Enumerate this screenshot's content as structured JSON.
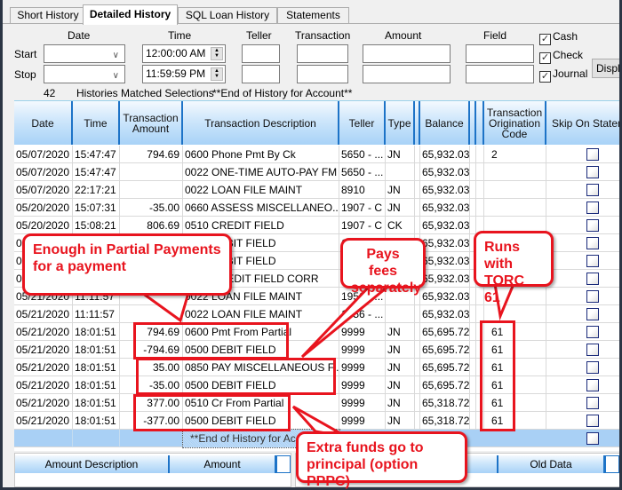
{
  "tabs": [
    {
      "label": "Short History",
      "active": false
    },
    {
      "label": "Detailed History",
      "active": true
    },
    {
      "label": "SQL Loan History",
      "active": false
    },
    {
      "label": "Statements",
      "active": false
    }
  ],
  "filters": {
    "headers": {
      "date": "Date",
      "time": "Time",
      "teller": "Teller",
      "transaction": "Transaction",
      "amount": "Amount",
      "field": "Field"
    },
    "start_label": "Start",
    "stop_label": "Stop",
    "start_date": "",
    "stop_date": "",
    "start_time": "12:00:00 AM",
    "stop_time": "11:59:59 PM",
    "checkboxes": [
      {
        "label": "Cash",
        "checked": true
      },
      {
        "label": "Check",
        "checked": true
      },
      {
        "label": "Journal",
        "checked": true
      }
    ],
    "display_button": "Display"
  },
  "status": {
    "count": "42",
    "matched_text": "Histories Matched Selections",
    "end_text": "**End of History for Account**"
  },
  "grid": {
    "columns": [
      "Date",
      "Time",
      "Transaction Amount",
      "Transaction Description",
      "Teller",
      "Type",
      "Balance",
      "Transaction Origination Code",
      "Skip On Statement"
    ],
    "rows": [
      {
        "date": "05/07/2020",
        "time": "15:47:47",
        "amount": "794.69",
        "desc": "0600 Phone Pmt By Ck",
        "teller": "5650 - ...",
        "type": "JN",
        "balance": "65,932.03",
        "torc": "2"
      },
      {
        "date": "05/07/2020",
        "time": "15:47:47",
        "amount": "",
        "desc": "0022 ONE-TIME AUTO-PAY FM",
        "teller": "5650 - ...",
        "type": "",
        "balance": "65,932.03",
        "torc": ""
      },
      {
        "date": "05/07/2020",
        "time": "22:17:21",
        "amount": "",
        "desc": "0022 LOAN FILE MAINT",
        "teller": "8910",
        "type": "JN",
        "balance": "65,932.03",
        "torc": ""
      },
      {
        "date": "05/20/2020",
        "time": "15:07:31",
        "amount": "-35.00",
        "desc": "0660 ASSESS MISCELLANEO...",
        "teller": "1907 - C",
        "type": "JN",
        "balance": "65,932.03",
        "torc": ""
      },
      {
        "date": "05/20/2020",
        "time": "15:08:21",
        "amount": "806.69",
        "desc": "0510 CREDIT FIELD",
        "teller": "1907 - C",
        "type": "CK",
        "balance": "65,932.03",
        "torc": ""
      },
      {
        "date": "05",
        "time": "",
        "amount": "",
        "desc": "0500 DEBIT FIELD",
        "teller": "1",
        "type": "",
        "balance": "65,932.03",
        "torc": ""
      },
      {
        "date": "05",
        "time": "",
        "amount": "",
        "desc": "0500 DEBIT FIELD",
        "teller": "1",
        "type": "",
        "balance": "65,932.03",
        "torc": ""
      },
      {
        "date": "05",
        "time": "",
        "amount": "",
        "desc": "0510 CREDIT FIELD CORR",
        "teller": "1",
        "type": "",
        "balance": "65,932.03",
        "torc": ""
      },
      {
        "date": "05/21/2020",
        "time": "11:11:57",
        "amount": "",
        "desc": "0022 LOAN FILE MAINT",
        "teller": "1956 - ...",
        "type": "",
        "balance": "65,932.03",
        "torc": ""
      },
      {
        "date": "05/21/2020",
        "time": "11:11:57",
        "amount": "",
        "desc": "0022 LOAN FILE MAINT",
        "teller": "1956 - ...",
        "type": "",
        "balance": "65,932.03",
        "torc": ""
      },
      {
        "date": "05/21/2020",
        "time": "18:01:51",
        "amount": "794.69",
        "desc": "0600 Pmt From Partial",
        "teller": "9999",
        "type": "JN",
        "balance": "65,695.72",
        "torc": "61"
      },
      {
        "date": "05/21/2020",
        "time": "18:01:51",
        "amount": "-794.69",
        "desc": "0500 DEBIT FIELD",
        "teller": "9999",
        "type": "JN",
        "balance": "65,695.72",
        "torc": "61"
      },
      {
        "date": "05/21/2020",
        "time": "18:01:51",
        "amount": "35.00",
        "desc": "0850 PAY MISCELLANEOUS F...",
        "teller": "9999",
        "type": "JN",
        "balance": "65,695.72",
        "torc": "61"
      },
      {
        "date": "05/21/2020",
        "time": "18:01:51",
        "amount": "-35.00",
        "desc": "0500 DEBIT FIELD",
        "teller": "9999",
        "type": "JN",
        "balance": "65,695.72",
        "torc": "61"
      },
      {
        "date": "05/21/2020",
        "time": "18:01:51",
        "amount": "377.00",
        "desc": "0510 Cr From Partial",
        "teller": "9999",
        "type": "JN",
        "balance": "65,318.72",
        "torc": "61"
      },
      {
        "date": "05/21/2020",
        "time": "18:01:51",
        "amount": "-377.00",
        "desc": "0500 DEBIT FIELD",
        "teller": "9999",
        "type": "JN",
        "balance": "65,318.72",
        "torc": "61"
      }
    ],
    "end_row_text": "**End of History for Acc"
  },
  "bottom_grid": {
    "left_columns": [
      "Amount Description",
      "Amount"
    ],
    "right_columns": [
      "Old Data"
    ]
  },
  "annotations": {
    "partial": "Enough in Partial Payments for a payment",
    "fees": "Pays fees separately",
    "torc": "Runs with TORC 61",
    "principal": "Extra funds go to principal (option PPPC)",
    "accent_color": "#e8141e"
  }
}
